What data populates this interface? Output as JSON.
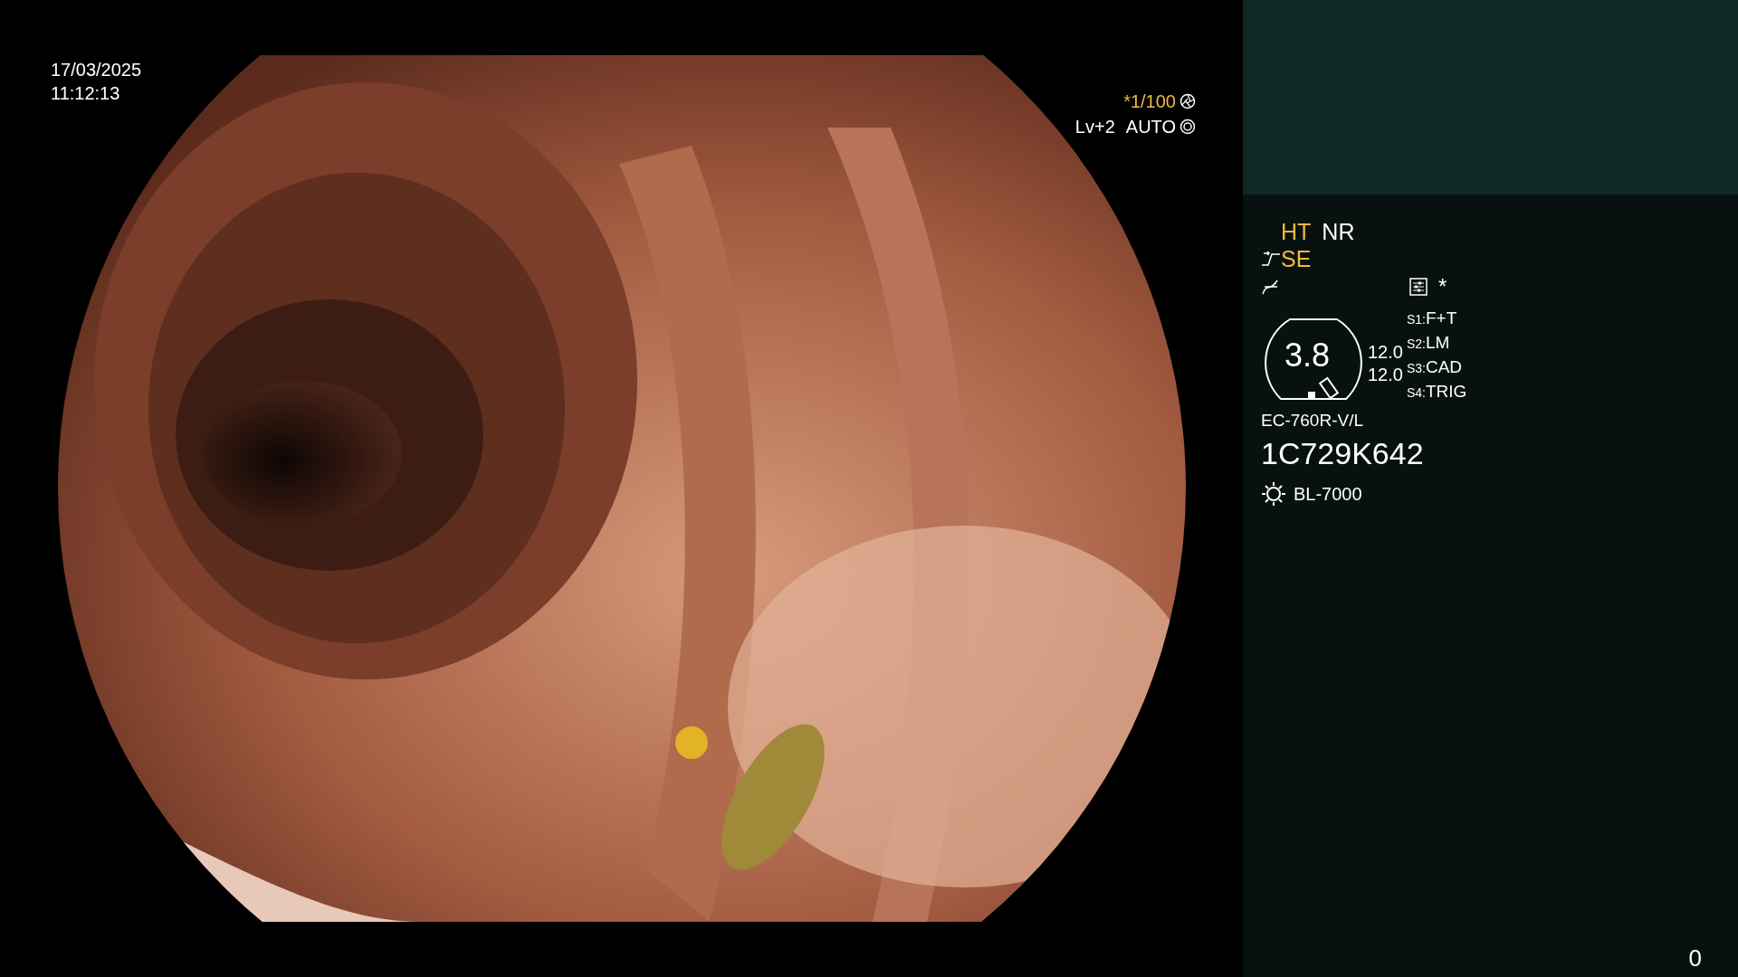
{
  "timestamp": {
    "date": "17/03/2025",
    "time": "11:12:13"
  },
  "exposure": {
    "shutter": "*1/100",
    "shutter_highlighted": true,
    "level": "Lv+2",
    "mode": "AUTO"
  },
  "panel": {
    "modes": [
      {
        "label": "HT",
        "highlighted": true
      },
      {
        "label": "NR",
        "highlighted": false
      }
    ],
    "structure": {
      "label": "SE",
      "highlighted": true
    },
    "extra_mark": "*",
    "gauge": {
      "value": "3.8",
      "readings": [
        "12.0",
        "12.0"
      ]
    },
    "switches": [
      {
        "key": "S1:",
        "value": "F+T"
      },
      {
        "key": "S2:",
        "value": "LM"
      },
      {
        "key": "S3:",
        "value": "CAD"
      },
      {
        "key": "S4:",
        "value": "TRIG"
      }
    ],
    "scope_model": "EC-760R-V/L",
    "scope_serial": "1C729K642",
    "light_source": "BL-7000"
  },
  "counter": "0"
}
